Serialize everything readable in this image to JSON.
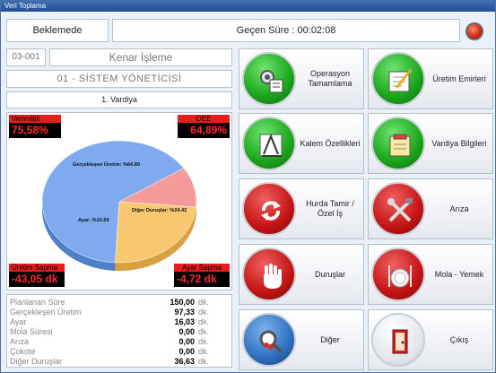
{
  "window": {
    "title": "Veri Toplama"
  },
  "header": {
    "status": "Beklemede",
    "elapsed": "Geçen Süre : 00:02:08"
  },
  "info": {
    "code": "03-001",
    "operation": "Kenar İşleme",
    "user": "01 - SİSTEM YÖNETİCİSİ",
    "shift": "1. Vardiya"
  },
  "kpis": {
    "efficiency_label": "Verimlilik",
    "efficiency_value": "75,58%",
    "oee_label": "OEE",
    "oee_value": "64,89%",
    "production_dev_label": "Üretim Sapma",
    "production_dev_value": "-43,05 dk",
    "setup_dev_label": "Ayar Sapma",
    "setup_dev_value": "-4,72 dk"
  },
  "chart_data": {
    "type": "pie",
    "categories": [
      "Gerçekleşen Üretim",
      "Ayar",
      "Diğer Duruşlar"
    ],
    "values": [
      64.89,
      10.69,
      24.42
    ],
    "labels": [
      "Gerçekleşen Üretim: %64.89",
      "Ayar: %10.69",
      "Diğer Duruşlar: %24.42"
    ],
    "colors": [
      "#7faaf0",
      "#f59a9a",
      "#f8c870"
    ]
  },
  "stats": [
    {
      "name": "Planlanan Süre",
      "value": "150,00",
      "unit": "dk."
    },
    {
      "name": "Gerçekleşen Üretim",
      "value": "97,33",
      "unit": "dk."
    },
    {
      "name": "Ayar",
      "value": "16,03",
      "unit": "dk."
    },
    {
      "name": "Mola Süresi",
      "value": "0,00",
      "unit": "dk."
    },
    {
      "name": "Arıza",
      "value": "0,00",
      "unit": "dk."
    },
    {
      "name": "Çokote",
      "value": "0,00",
      "unit": "dk."
    },
    {
      "name": "Diğer Duruşlar",
      "value": "36,63",
      "unit": "dk."
    }
  ],
  "menu": {
    "operation_complete": "Operasyon Tamamlama",
    "production_orders": "Üretim Emirleri",
    "item_properties": "Kalem Özellikleri",
    "shift_info": "Vardiya Bilgileri",
    "scrap_repair": "Hurda Tamir / Özel İş",
    "fault": "Arıza",
    "stoppages": "Duruşlar",
    "break_meal": "Mola - Yemek",
    "other": "Diğer",
    "exit": "Çıkış"
  },
  "icons": {
    "operation_complete": "gear-checklist-icon",
    "production_orders": "pencil-notepad-icon",
    "item_properties": "ruler-square-icon",
    "shift_info": "notepad-icon",
    "scrap_repair": "refresh-arrows-icon",
    "fault": "tools-icon",
    "stoppages": "hand-stop-icon",
    "break_meal": "plate-cutlery-icon",
    "other": "magnifier-icon",
    "exit": "door-exit-icon"
  }
}
